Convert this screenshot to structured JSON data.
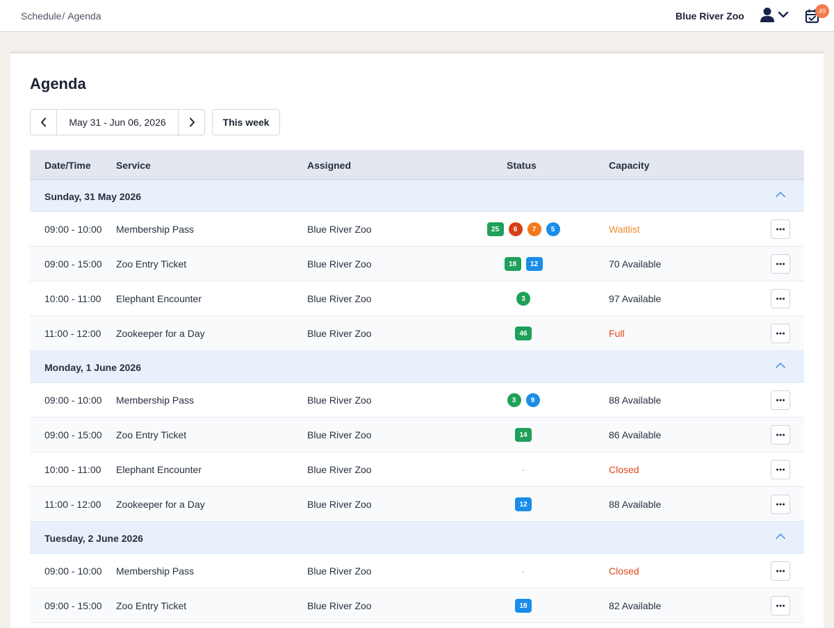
{
  "topbar": {
    "breadcrumb": [
      "Schedule",
      "Agenda"
    ],
    "breadcrumb_sep": "/",
    "org_name": "Blue River Zoo",
    "notification_count": "49",
    "icons": [
      "user-icon",
      "chevron-down-icon",
      "calendar-check-icon"
    ]
  },
  "page": {
    "title": "Agenda",
    "date_range": "May 31 - Jun 06, 2026",
    "this_week_label": "This week"
  },
  "colors": {
    "green": "#1fa05a",
    "red": "#d63f15",
    "orange": "#f47a1c",
    "blue": "#1a8de8",
    "waitlist": "#f28c2e",
    "full_closed": "#e0481b"
  },
  "table": {
    "columns": [
      "Date/Time",
      "Service",
      "Assigned",
      "Status",
      "Capacity"
    ],
    "groups": [
      {
        "title": "Sunday, 31 May 2026",
        "rows": [
          {
            "time": "09:00 - 10:00",
            "service": "Membership Pass",
            "assigned": "Blue River Zoo",
            "badges": [
              {
                "value": "25",
                "color": "green",
                "shape": "rect"
              },
              {
                "value": "6",
                "color": "red",
                "shape": "circ"
              },
              {
                "value": "7",
                "color": "orange",
                "shape": "circ"
              },
              {
                "value": "5",
                "color": "blue",
                "shape": "circ"
              }
            ],
            "capacity": "Waitlist",
            "capacity_style": "orange"
          },
          {
            "time": "09:00 - 15:00",
            "service": "Zoo Entry Ticket",
            "assigned": "Blue River Zoo",
            "badges": [
              {
                "value": "18",
                "color": "green",
                "shape": "rect"
              },
              {
                "value": "12",
                "color": "blue",
                "shape": "rect"
              }
            ],
            "capacity": "70 Available",
            "capacity_style": "normal"
          },
          {
            "time": "10:00 - 11:00",
            "service": "Elephant Encounter",
            "assigned": "Blue River Zoo",
            "badges": [
              {
                "value": "3",
                "color": "green",
                "shape": "circ"
              }
            ],
            "capacity": "97 Available",
            "capacity_style": "normal"
          },
          {
            "time": "11:00 - 12:00",
            "service": "Zookeeper for a Day",
            "assigned": "Blue River Zoo",
            "badges": [
              {
                "value": "46",
                "color": "green",
                "shape": "rect"
              }
            ],
            "capacity": "Full",
            "capacity_style": "red"
          }
        ]
      },
      {
        "title": "Monday, 1 June 2026",
        "rows": [
          {
            "time": "09:00 - 10:00",
            "service": "Membership Pass",
            "assigned": "Blue River Zoo",
            "badges": [
              {
                "value": "3",
                "color": "green",
                "shape": "circ"
              },
              {
                "value": "9",
                "color": "blue",
                "shape": "circ"
              }
            ],
            "capacity": "88 Available",
            "capacity_style": "normal"
          },
          {
            "time": "09:00 - 15:00",
            "service": "Zoo Entry Ticket",
            "assigned": "Blue River Zoo",
            "badges": [
              {
                "value": "14",
                "color": "green",
                "shape": "rect"
              }
            ],
            "capacity": "86 Available",
            "capacity_style": "normal"
          },
          {
            "time": "10:00 - 11:00",
            "service": "Elephant Encounter",
            "assigned": "Blue River Zoo",
            "badges": [],
            "empty_status": "-",
            "capacity": "Closed",
            "capacity_style": "red"
          },
          {
            "time": "11:00 - 12:00",
            "service": "Zookeeper for a Day",
            "assigned": "Blue River Zoo",
            "badges": [
              {
                "value": "12",
                "color": "blue",
                "shape": "rect"
              }
            ],
            "capacity": "88 Available",
            "capacity_style": "normal"
          }
        ]
      },
      {
        "title": "Tuesday, 2 June 2026",
        "rows": [
          {
            "time": "09:00 - 10:00",
            "service": "Membership Pass",
            "assigned": "Blue River Zoo",
            "badges": [],
            "empty_status": "-",
            "capacity": "Closed",
            "capacity_style": "red"
          },
          {
            "time": "09:00 - 15:00",
            "service": "Zoo Entry Ticket",
            "assigned": "Blue River Zoo",
            "badges": [
              {
                "value": "18",
                "color": "blue",
                "shape": "rect"
              }
            ],
            "capacity": "82 Available",
            "capacity_style": "normal"
          }
        ]
      }
    ]
  }
}
